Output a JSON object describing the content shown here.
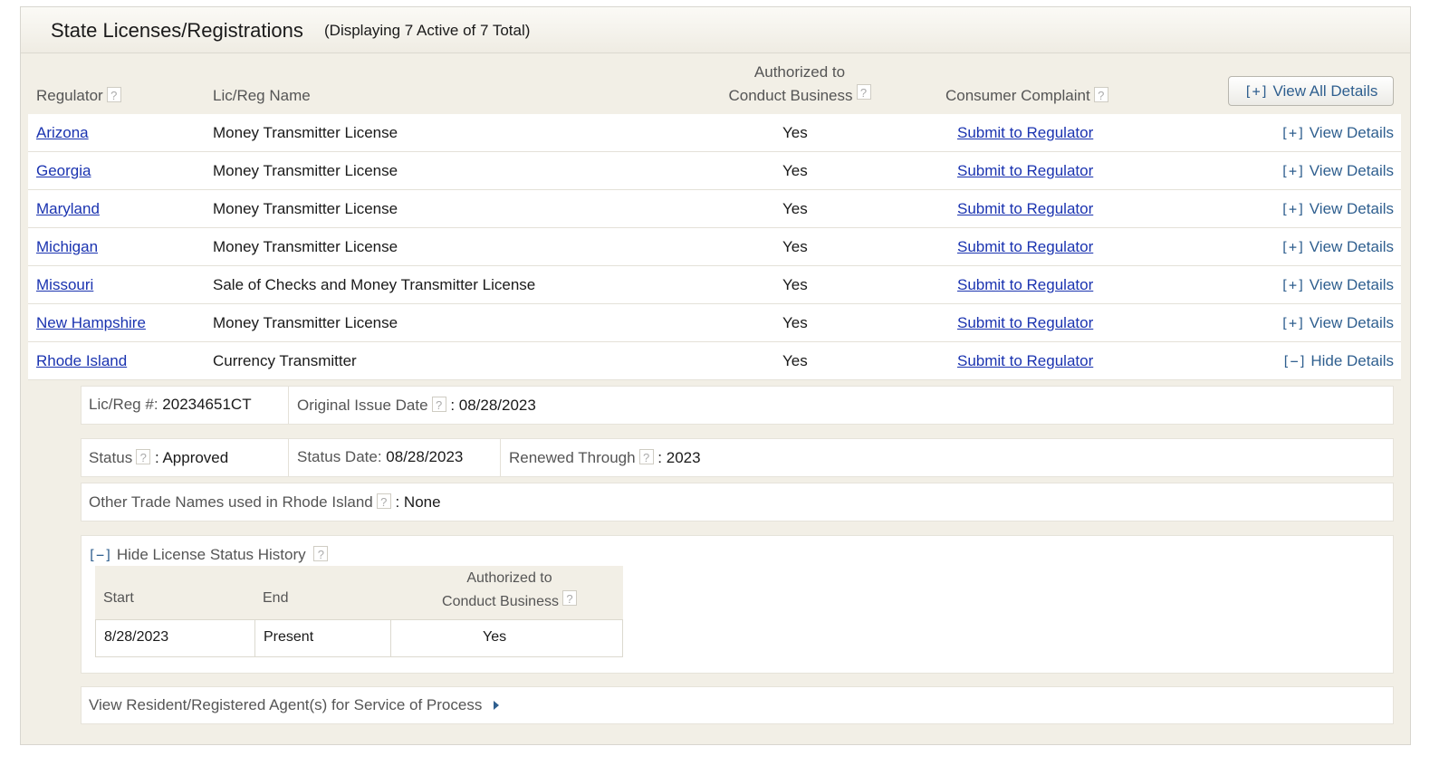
{
  "panel": {
    "title": "State Licenses/Registrations",
    "subtitle": "(Displaying 7 Active of 7 Total)"
  },
  "table": {
    "headers": {
      "regulator": "Regulator",
      "name": "Lic/Reg Name",
      "auth_line1": "Authorized to",
      "auth_line2": "Conduct Business",
      "complaint": "Consumer Complaint"
    },
    "view_all_label": "View All Details",
    "view_all_bracket": "[+]",
    "rows": [
      {
        "regulator": "Arizona",
        "name": "Money Transmitter License",
        "authorized": "Yes",
        "complaint": "Submit to Regulator",
        "toggle_bracket": "[+]",
        "toggle": "View Details"
      },
      {
        "regulator": "Georgia",
        "name": "Money Transmitter License",
        "authorized": "Yes",
        "complaint": "Submit to Regulator",
        "toggle_bracket": "[+]",
        "toggle": "View Details"
      },
      {
        "regulator": "Maryland",
        "name": "Money Transmitter License",
        "authorized": "Yes",
        "complaint": "Submit to Regulator",
        "toggle_bracket": "[+]",
        "toggle": "View Details"
      },
      {
        "regulator": "Michigan",
        "name": "Money Transmitter License",
        "authorized": "Yes",
        "complaint": "Submit to Regulator",
        "toggle_bracket": "[+]",
        "toggle": "View Details"
      },
      {
        "regulator": "Missouri",
        "name": "Sale of Checks and Money Transmitter License",
        "authorized": "Yes",
        "complaint": "Submit to Regulator",
        "toggle_bracket": "[+]",
        "toggle": "View Details"
      },
      {
        "regulator": "New Hampshire",
        "name": "Money Transmitter License",
        "authorized": "Yes",
        "complaint": "Submit to Regulator",
        "toggle_bracket": "[+]",
        "toggle": "View Details"
      },
      {
        "regulator": "Rhode Island",
        "name": "Currency Transmitter",
        "authorized": "Yes",
        "complaint": "Submit to Regulator",
        "toggle_bracket": "[−]",
        "toggle": "Hide Details"
      }
    ]
  },
  "details": {
    "licreg_label": "Lic/Reg #:",
    "licreg_value": "20234651CT",
    "issue_label": "Original Issue Date",
    "issue_value": ": 08/28/2023",
    "status_label": "Status",
    "status_value": ": Approved",
    "status_date_label": "Status Date:",
    "status_date_value": "08/28/2023",
    "renewed_label": "Renewed Through",
    "renewed_value": ": 2023",
    "trade_label": "Other Trade Names used in Rhode Island",
    "trade_value": ": None",
    "history_bracket": "[−]",
    "history_toggle": "Hide License Status History",
    "history": {
      "headers": {
        "start": "Start",
        "end": "End",
        "auth_line1": "Authorized to",
        "auth_line2": "Conduct Business"
      },
      "rows": [
        {
          "start": "8/28/2023",
          "end": "Present",
          "authorized": "Yes"
        }
      ]
    },
    "agents_link": "View Resident/Registered Agent(s) for Service of Process"
  },
  "help_glyph": "?",
  "colors": {
    "link": "#1a33b0",
    "accent": "#2f5f8f",
    "panel_bg": "#f2efe6"
  }
}
